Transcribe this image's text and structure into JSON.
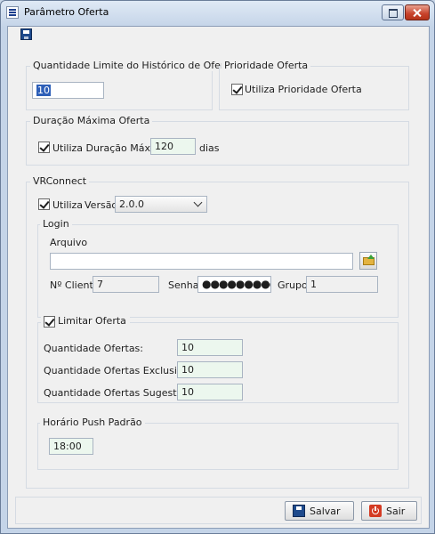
{
  "window": {
    "title": "Parâmetro Oferta"
  },
  "historico": {
    "label": "Quantidade Limite do Histórico de Ofertas",
    "value": "10"
  },
  "prioridade": {
    "label": "Prioridade Oferta",
    "checkbox_label": "Utiliza Prioridade Oferta",
    "checked": true
  },
  "duracao": {
    "label": "Duração Máxima Oferta",
    "checkbox_label": "Utiliza Duração Máxima",
    "checked": true,
    "value": "120",
    "unit": "dias"
  },
  "vrconnect": {
    "label": "VRConnect",
    "utiliza_label": "Utiliza",
    "utiliza_checked": true,
    "versao_label": "Versão",
    "versao_value": "2.0.0",
    "login": {
      "label": "Login",
      "arquivo_label": "Arquivo",
      "arquivo_value": "",
      "cliente_label": "Nº Cliente",
      "cliente_value": "7",
      "senha_label": "Senha",
      "senha_value": "●●●●●●●●●●●●",
      "grupo_label": "Grupo",
      "grupo_value": "1"
    },
    "limitar": {
      "checkbox_label": "Limitar Oferta",
      "checked": true,
      "rows": [
        {
          "label": "Quantidade Ofertas:",
          "value": "10"
        },
        {
          "label": "Quantidade Ofertas Exclusivas:",
          "value": "10"
        },
        {
          "label": "Quantidade Ofertas Sugestões:",
          "value": "10"
        }
      ]
    },
    "push": {
      "label": "Horário Push Padrão",
      "value": "18:00"
    }
  },
  "buttons": {
    "save_label": "Salvar",
    "exit_label": "Sair"
  },
  "colors": {
    "accent": "#2d5fb8",
    "field_green": "#ecf7ee",
    "close_red": "#c7412a"
  }
}
